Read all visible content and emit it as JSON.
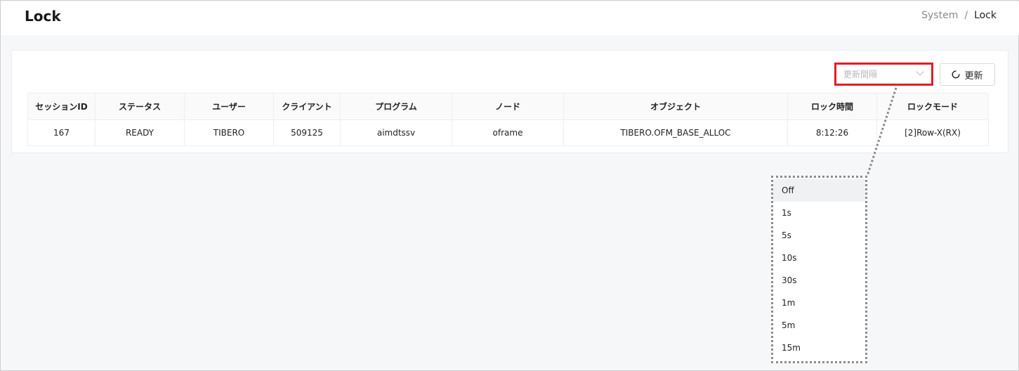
{
  "header": {
    "title": "Lock",
    "breadcrumb": [
      "System",
      "/",
      "Lock"
    ]
  },
  "toolbar": {
    "interval_placeholder": "更新間隔",
    "refresh_label": "更新",
    "refresh_icon": "refresh-icon",
    "chevron_icon": "chevron-down-icon"
  },
  "table": {
    "columns": [
      "セッションID",
      "ステータス",
      "ユーザー",
      "クライアント",
      "プログラム",
      "ノード",
      "オブジェクト",
      "ロック時間",
      "ロックモード"
    ],
    "rows": [
      [
        "167",
        "READY",
        "TIBERO",
        "509125",
        "aimdtssv",
        "oframe",
        "TIBERO.OFM_BASE_ALLOC",
        "8:12:26",
        "[2]Row-X(RX)"
      ]
    ]
  },
  "dropdown": {
    "options": [
      "Off",
      "1s",
      "5s",
      "10s",
      "30s",
      "1m",
      "5m",
      "15m"
    ],
    "selected": "Off"
  },
  "colors": {
    "highlight": "#e01e26",
    "background": "#f6f7f8"
  }
}
